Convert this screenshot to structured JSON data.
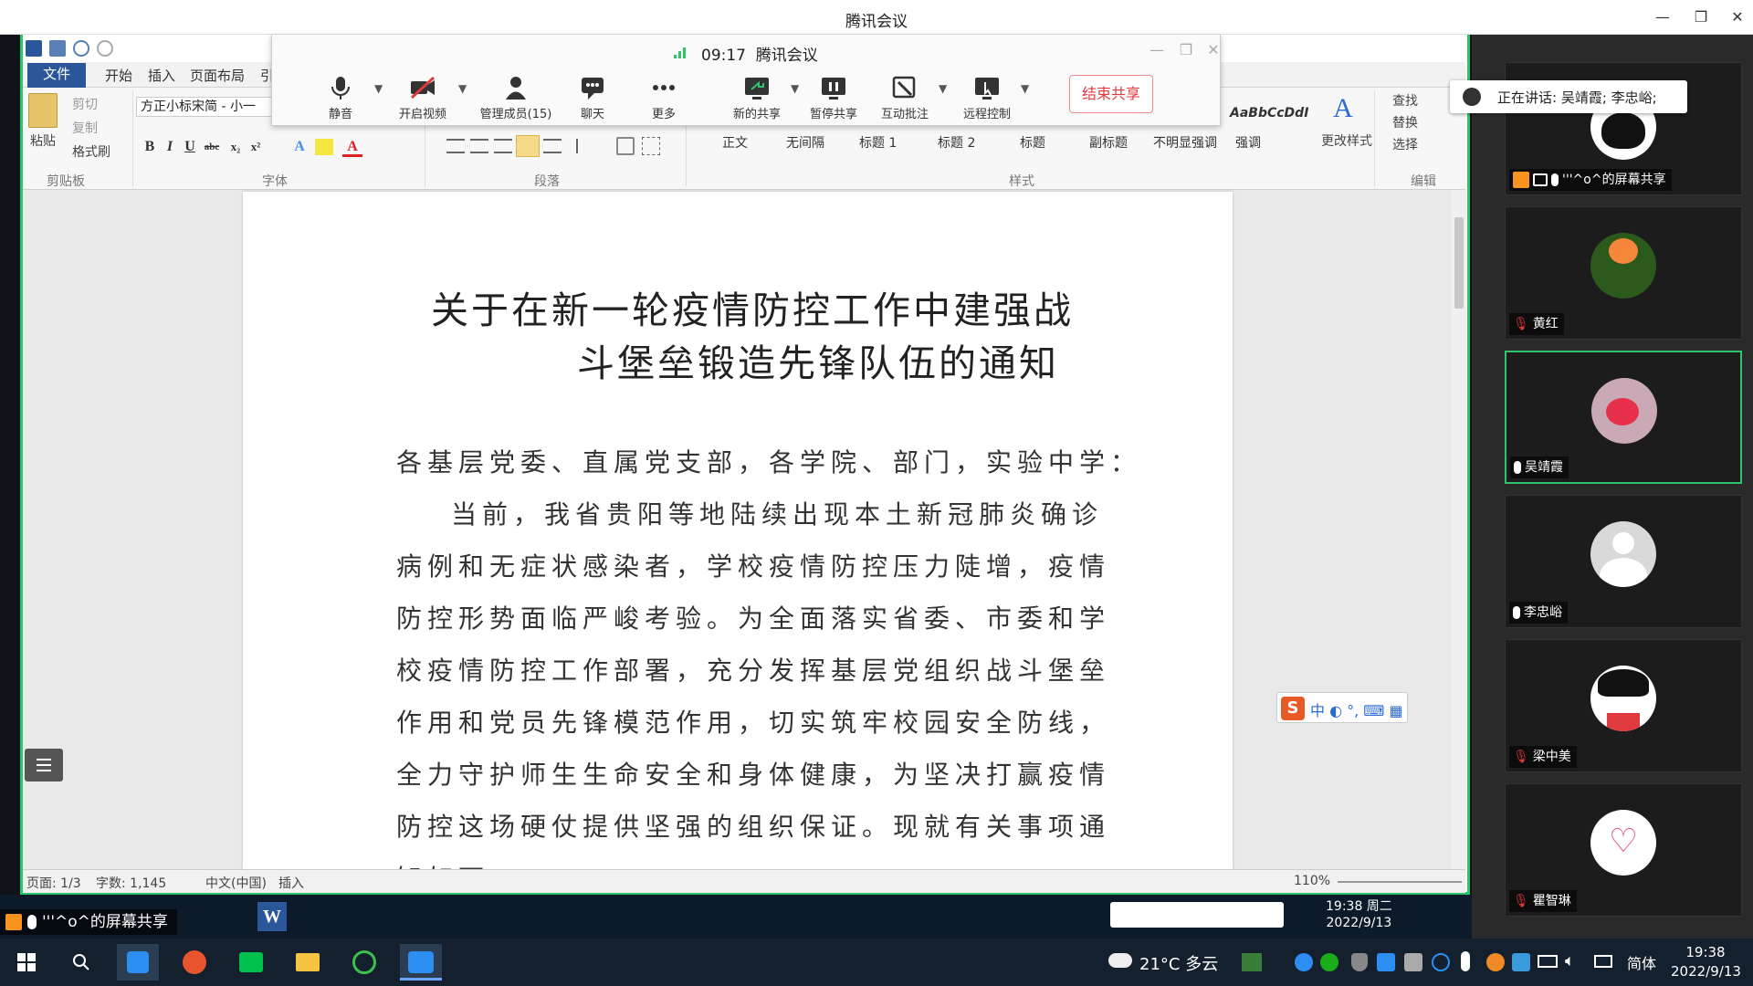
{
  "window": {
    "title": "腾讯会议",
    "minimize": "—",
    "maximize": "❐",
    "close": "✕"
  },
  "word": {
    "tabs": [
      "文件",
      "开始",
      "插入",
      "页面布局",
      "引"
    ],
    "clipboard": {
      "paste": "粘贴",
      "cut": "剪切",
      "copy": "复制",
      "format_painter": "格式刷",
      "group": "剪贴板"
    },
    "font": {
      "name": "方正小标宋简 - 小一",
      "group": "字体",
      "bold": "B",
      "italic": "I",
      "underline": "U",
      "strike": "abc",
      "sub": "x₂",
      "sup": "x²",
      "text_effect": "A",
      "font_color": "A"
    },
    "paragraph": {
      "group": "段落"
    },
    "styles": {
      "group": "样式",
      "items": [
        "正文",
        "无间隔",
        "标题 1",
        "标题 2",
        "标题",
        "副标题",
        "不明显强调",
        "强调"
      ],
      "preview": "AaBbCcDdI",
      "change_styles": "更改样式"
    },
    "editing": {
      "group": "编辑",
      "find": "查找",
      "replace": "替换",
      "select": "选择"
    },
    "status": {
      "page": "页面: 1/3",
      "words": "字数: 1,145",
      "language": "中文(中国)",
      "mode": "插入",
      "zoom": "110%"
    },
    "document": {
      "title_line1": "关于在新一轮疫情防控工作中建强战",
      "title_line2": "斗堡垒锻造先锋队伍的通知",
      "lines": [
        "各基层党委、直属党支部，各学院、部门，实验中学：",
        "当前，我省贵阳等地陆续出现本土新冠肺炎确诊",
        "病例和无症状感染者，学校疫情防控压力陡增，疫情",
        "防控形势面临严峻考验。为全面落实省委、市委和学",
        "校疫情防控工作部署，充分发挥基层党组织战斗堡垒",
        "作用和党员先锋模范作用，切实筑牢校园安全防线，",
        "全力守护师生生命安全和身体健康，为坚决打赢疫情",
        "防控这场硬仗提供坚强的组织保证。现就有关事项通",
        "知如下："
      ]
    },
    "ime": "中 ◐ °, ⌨ ▦"
  },
  "meeting_toolbar": {
    "time": "09:17",
    "app": "腾讯会议",
    "buttons": [
      {
        "label": "静音",
        "icon": "microphone-icon"
      },
      {
        "label": "开启视频",
        "icon": "video-off-icon"
      },
      {
        "label": "管理成员(15)",
        "icon": "members-icon"
      },
      {
        "label": "聊天",
        "icon": "chat-icon"
      },
      {
        "label": "更多",
        "icon": "more-icon"
      },
      {
        "label": "新的共享",
        "icon": "new-share-icon"
      },
      {
        "label": "暂停共享",
        "icon": "pause-share-icon"
      },
      {
        "label": "互动批注",
        "icon": "annotate-icon"
      },
      {
        "label": "远程控制",
        "icon": "remote-control-icon"
      }
    ],
    "end_share": "结束共享"
  },
  "inner_taskbar": {
    "share_label": "'''^o^的屏幕共享",
    "clock_time": "19:38 周二",
    "clock_date": "2022/9/13"
  },
  "participants": {
    "speaking": "正在讲话: 吴靖霞; 李忠峪;",
    "list": [
      {
        "name": "'''^o^的屏幕共享",
        "muted": false,
        "sharing": true,
        "avatar": "cartoon-avatar"
      },
      {
        "name": "黄红",
        "muted": true,
        "avatar": "flower-avatar"
      },
      {
        "name": "吴靖霞",
        "muted": false,
        "active": true,
        "avatar": "rose-avatar"
      },
      {
        "name": "李忠峪",
        "muted": false,
        "avatar": "default-avatar"
      },
      {
        "name": "梁中美",
        "muted": true,
        "avatar": "girl-avatar"
      },
      {
        "name": "瞿智琳",
        "muted": true,
        "avatar": "text-avatar"
      }
    ]
  },
  "taskbar": {
    "weather": "21°C 多云",
    "lang": "简体",
    "time": "19:38",
    "date": "2022/9/13"
  },
  "colors": {
    "word_blue": "#2b579a",
    "share_green": "#2ec46b",
    "end_red": "#e0393e"
  }
}
